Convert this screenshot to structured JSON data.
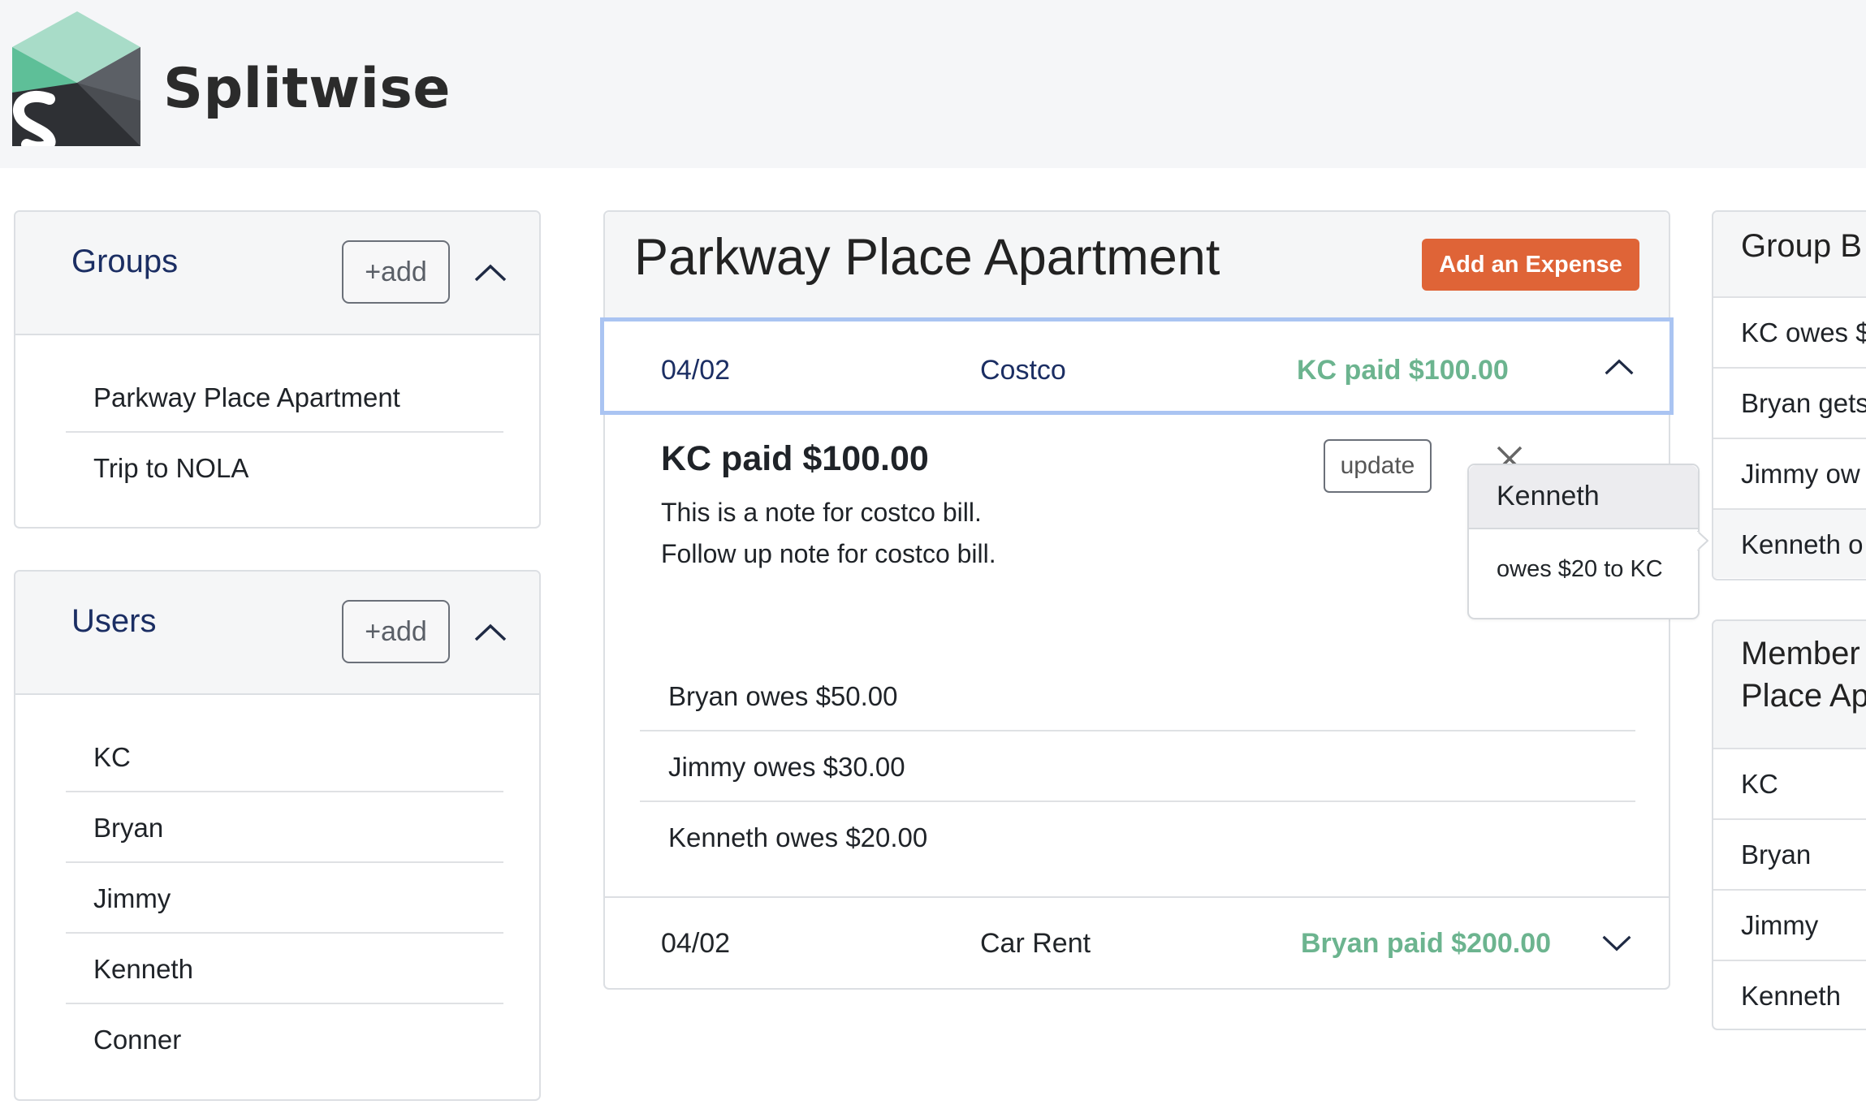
{
  "app": {
    "name": "Splitwise"
  },
  "groups": {
    "title": "Groups",
    "add_label": "+add",
    "items": [
      "Parkway Place Apartment",
      "Trip to NOLA"
    ]
  },
  "users": {
    "title": "Users",
    "add_label": "+add",
    "items": [
      "KC",
      "Bryan",
      "Jimmy",
      "Kenneth",
      "Conner"
    ]
  },
  "main": {
    "title": "Parkway Place Apartment",
    "add_expense_label": "Add an Expense",
    "expenses": [
      {
        "date": "04/02",
        "description": "Costco",
        "paid": "KC paid $100.00",
        "expanded": true
      },
      {
        "date": "04/02",
        "description": "Car Rent",
        "paid": "Bryan paid $200.00",
        "expanded": false
      }
    ],
    "detail": {
      "title": "KC paid $100.00",
      "update_label": "update",
      "notes": [
        "This is a note for costco bill.",
        "Follow up note for costco bill."
      ],
      "owes": [
        "Bryan owes $50.00",
        "Jimmy owes $30.00",
        "Kenneth owes $20.00"
      ]
    }
  },
  "popover": {
    "title": "Kenneth",
    "body": "owes $20 to KC"
  },
  "right": {
    "balances_title": "Group B",
    "balances": [
      "KC owes $",
      "Bryan gets",
      "Jimmy ow",
      "Kenneth o"
    ],
    "members_title_line1": "Member",
    "members_title_line2": "Place Ap",
    "members": [
      "KC",
      "Bryan",
      "Jimmy",
      "Kenneth"
    ]
  },
  "colors": {
    "accent_orange": "#df6437",
    "paid_green": "#6cb48f",
    "title_navy": "#1b2e63",
    "active_border": "#aac4f2"
  },
  "icons": [
    "splitwise-logo",
    "chevron-up-icon",
    "chevron-down-icon",
    "close-icon"
  ]
}
